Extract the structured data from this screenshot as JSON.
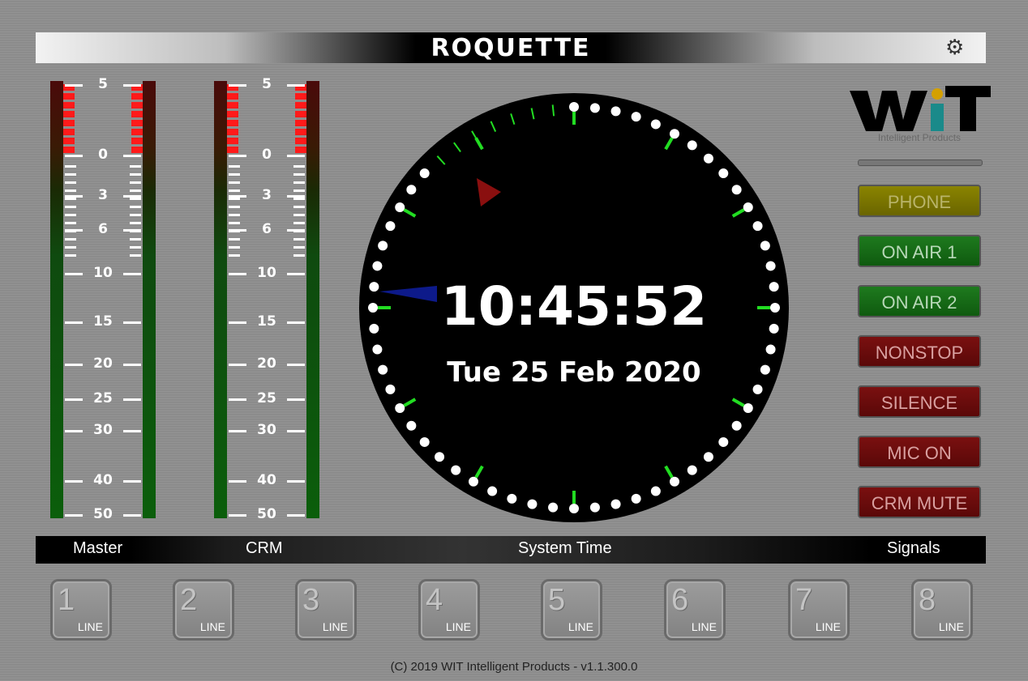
{
  "header": {
    "title": "ROQUETTE",
    "settings_icon": "gear-icon"
  },
  "meters": [
    {
      "name": "Master",
      "scale": [
        "5",
        "0",
        "3",
        "6",
        "10",
        "15",
        "20",
        "25",
        "30",
        "40",
        "50"
      ]
    },
    {
      "name": "CRM",
      "scale": [
        "5",
        "0",
        "3",
        "6",
        "10",
        "15",
        "20",
        "25",
        "30",
        "40",
        "50"
      ]
    }
  ],
  "clock": {
    "section_label": "System Time",
    "time": "10:45:52",
    "date": "Tue 25 Feb 2020"
  },
  "signals": {
    "section_label": "Signals",
    "logo_text": "WiT",
    "logo_tagline": "Intelligent Products",
    "buttons": [
      {
        "label": "PHONE",
        "state": "yellow"
      },
      {
        "label": "ON AIR 1",
        "state": "green"
      },
      {
        "label": "ON AIR 2",
        "state": "green"
      },
      {
        "label": "NONSTOP",
        "state": "red"
      },
      {
        "label": "SILENCE",
        "state": "red"
      },
      {
        "label": "MIC ON",
        "state": "red"
      },
      {
        "label": "CRM MUTE",
        "state": "red"
      }
    ]
  },
  "lines": [
    {
      "number": "1",
      "tag": "LINE"
    },
    {
      "number": "2",
      "tag": "LINE"
    },
    {
      "number": "3",
      "tag": "LINE"
    },
    {
      "number": "4",
      "tag": "LINE"
    },
    {
      "number": "5",
      "tag": "LINE"
    },
    {
      "number": "6",
      "tag": "LINE"
    },
    {
      "number": "7",
      "tag": "LINE"
    },
    {
      "number": "8",
      "tag": "LINE"
    }
  ],
  "footer": "(C) 2019  WIT Intelligent Products - v1.1.300.0",
  "colors": {
    "accent_green": "#22dd22",
    "second_dot": "#ffffff",
    "hand_red": "#8a0f0f",
    "hand_blue": "#0d1a8a"
  }
}
